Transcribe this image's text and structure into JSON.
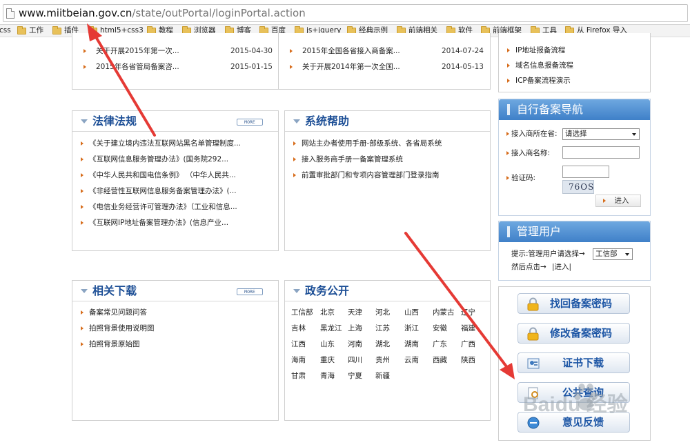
{
  "browser": {
    "url_host": "www.miitbeian.gov.cn",
    "url_path": "/state/outPortal/loginPortal.action",
    "bookmarks": [
      "css",
      "工作",
      "插件",
      "html5+css3",
      "教程",
      "浏览器",
      "博客",
      "百度",
      "js+jquery",
      "经典示例",
      "前端相关",
      "软件",
      "前端框架",
      "工具",
      "从 Firefox 导入"
    ]
  },
  "news_left": [
    {
      "title": "关于开展2015年第一次...",
      "date": "2015-04-30"
    },
    {
      "title": "2015年各省管局备案咨...",
      "date": "2015-01-15"
    }
  ],
  "news_right": [
    {
      "title": "2015年全国各省接入商备案...",
      "date": "2014-07-24"
    },
    {
      "title": "关于开展2014年第一次全国...",
      "date": "2014-05-13"
    }
  ],
  "process_links": [
    "IP地址报备流程",
    "域名信息报备流程",
    "ICP备案流程演示"
  ],
  "laws": {
    "title": "法律法规",
    "more": "MORE",
    "items": [
      "《关于建立境内违法互联网站黑名单管理制度...",
      "《互联网信息服务管理办法》(国务院292...",
      "《中华人民共和国电信条例》 （中华人民共...",
      "《非经营性互联网信息服务备案管理办法》(...",
      "《电信业务经营许可管理办法》（工业和信息...",
      "《互联网IP地址备案管理办法》(信息产业..."
    ]
  },
  "help": {
    "title": "系统帮助",
    "items": [
      "网站主办者使用手册-部级系统、各省局系统",
      "接入服务商手册一备案管理系统",
      "前置审批部门和专项内容管理部门登录指南"
    ]
  },
  "downloads": {
    "title": "相关下载",
    "more": "MORE",
    "items": [
      "备案常见问题问答",
      "拍照背景使用说明图",
      "拍照背景原始图"
    ]
  },
  "gov": {
    "title": "政务公开",
    "provinces": [
      "工信部",
      "北京",
      "天津",
      "河北",
      "山西",
      "内蒙古",
      "辽宁",
      "吉林",
      "黑龙江",
      "上海",
      "江苏",
      "浙江",
      "安徽",
      "福建",
      "江西",
      "山东",
      "河南",
      "湖北",
      "湖南",
      "广东",
      "广西",
      "海南",
      "重庆",
      "四川",
      "贵州",
      "云南",
      "西藏",
      "陕西",
      "甘肃",
      "青海",
      "宁夏",
      "新疆"
    ]
  },
  "self_filing": {
    "title": "自行备案导航",
    "province_label": "接入商所在省:",
    "province_value": "请选择",
    "name_label": "接入商名称:",
    "name_value": "",
    "captcha_label": "验证码:",
    "captcha_value": "",
    "captcha_image_text": "76OS",
    "enter_label": "进入"
  },
  "admin": {
    "title": "管理用户",
    "hint_label": "提示:管理用户请选择→",
    "select_value": "工信部",
    "then_label": "然后点击→",
    "enter_link": "|进入|"
  },
  "services": [
    {
      "label": "找回备案密码",
      "icon": "lock-icon"
    },
    {
      "label": "修改备案密码",
      "icon": "lock-icon"
    },
    {
      "label": "证书下载",
      "icon": "certificate-icon"
    },
    {
      "label": "公共查询",
      "icon": "search-doc-icon"
    },
    {
      "label": "意见反馈",
      "icon": "feedback-icon"
    }
  ],
  "watermark_text": "Baidu 经验",
  "colors": {
    "title_blue": "#1d4f96",
    "bullet_orange": "#d76d1c",
    "arrow_red": "#e53a35",
    "header_blue": "#4d8dd0"
  }
}
